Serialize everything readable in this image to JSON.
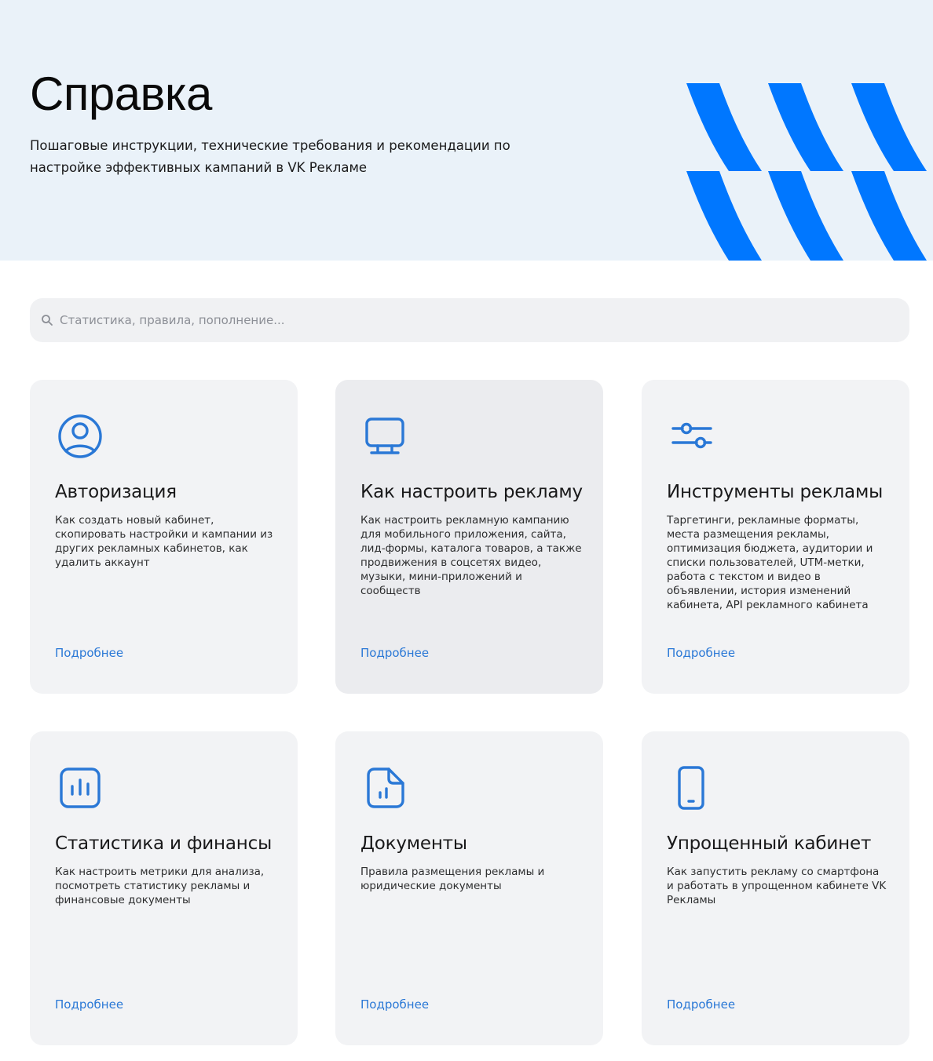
{
  "hero": {
    "title": "Справка",
    "subtitle": "Пошаговые инструкции, технические требования и рекомендации по настройке эффективных кампаний в VK Рекламе",
    "pattern_color": "#0077ff",
    "background_color": "#eaf2f9"
  },
  "search": {
    "placeholder": "Статистика, правила, пополнение...",
    "value": "",
    "icon": "search-icon"
  },
  "accent_color": "#2a78d6",
  "cards": [
    {
      "icon": "user-circle-icon",
      "title": "Авторизация",
      "description": "Как создать новый кабинет, скопировать настройки и кампании из других рекламных кабинетов, как удалить аккаунт",
      "link": "Подробнее"
    },
    {
      "icon": "monitor-icon",
      "title": "Как настроить рекламу",
      "description": "Как настроить рекламную кампанию для мобильного приложения, сайта, лид-формы, каталога товаров, а также продвижения в соцсетях видео, музыки, мини-приложений и сообществ",
      "link": "Подробнее"
    },
    {
      "icon": "sliders-icon",
      "title": "Инструменты рекламы",
      "description": "Таргетинги, рекламные форматы, места размещения рекламы, оптимизация бюджета, аудитории и списки пользователей, UTM-метки, работа с текстом и видео в объявлении, история изменений кабинета, API рекламного кабинета",
      "link": "Подробнее"
    },
    {
      "icon": "bar-chart-icon",
      "title": "Статистика и финансы",
      "description": "Как настроить метрики для анализа, посмотреть статистику рекламы и финансовые документы",
      "link": "Подробнее"
    },
    {
      "icon": "document-chart-icon",
      "title": "Документы",
      "description": "Правила размещения рекламы и юридические документы",
      "link": "Подробнее"
    },
    {
      "icon": "smartphone-icon",
      "title": "Упрощенный кабинет",
      "description": "Как запустить рекламу со смартфона и работать в упрощенном кабинете VK Рекламы",
      "link": "Подробнее"
    }
  ]
}
